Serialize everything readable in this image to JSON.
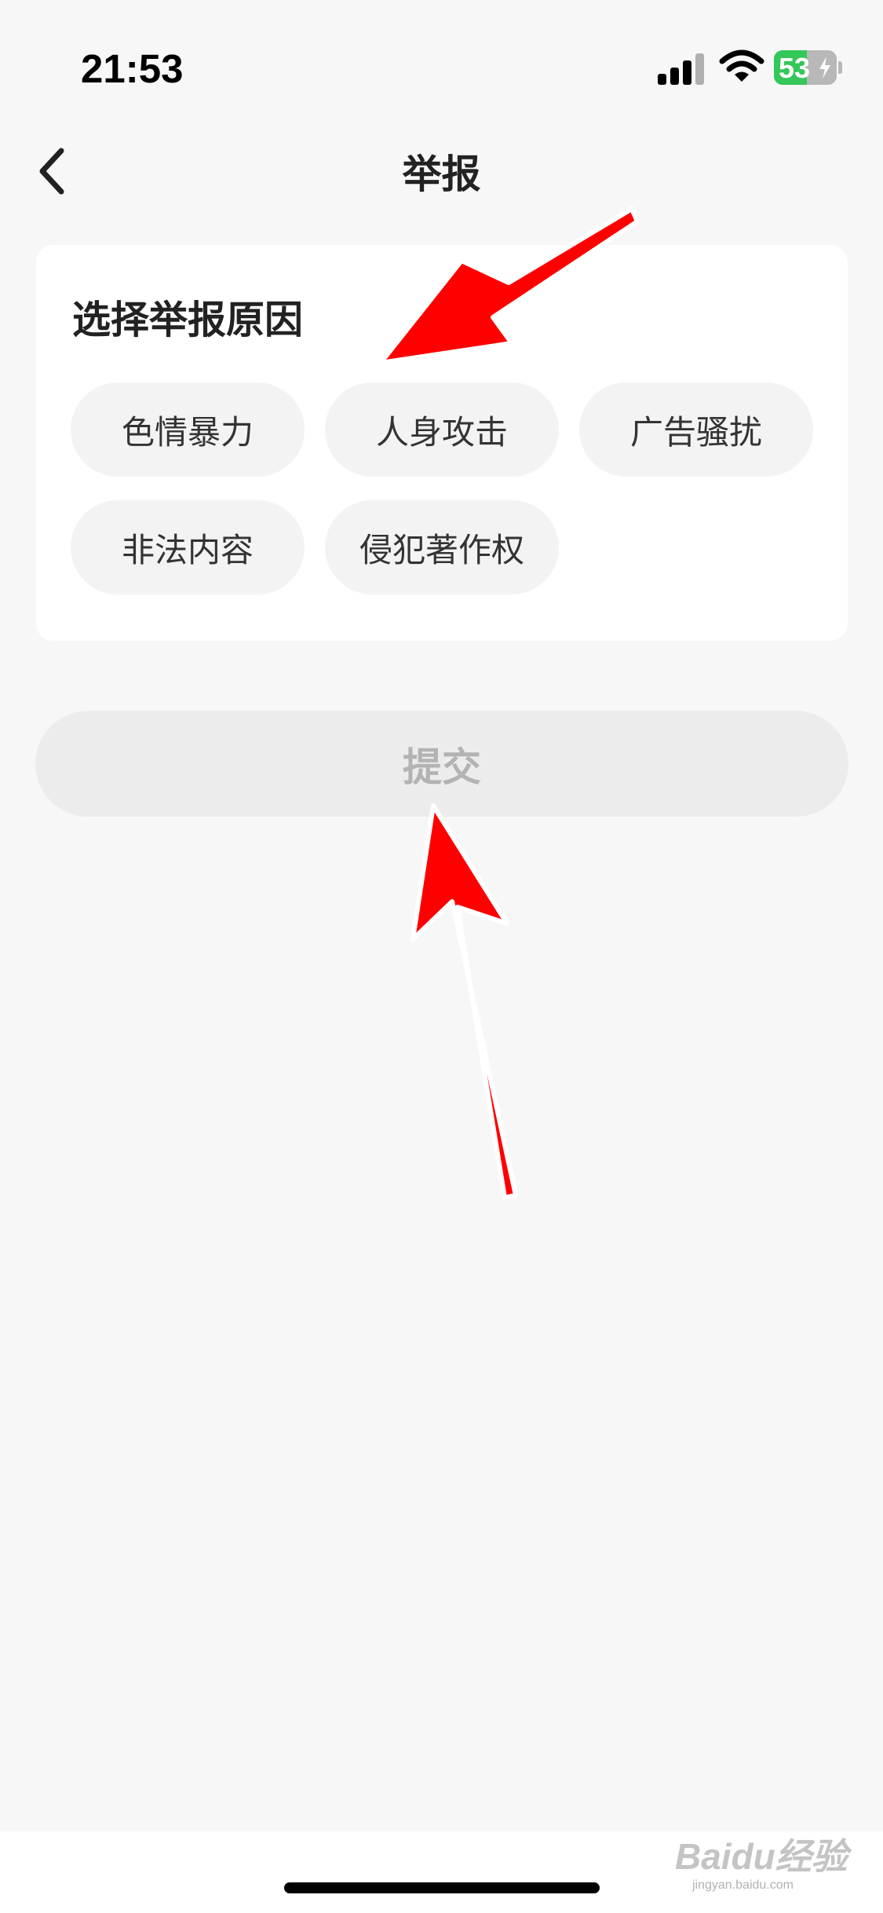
{
  "status_bar": {
    "time": "21:53",
    "battery_percent": 53,
    "battery_label": "53",
    "battery_color": "#34c759"
  },
  "nav": {
    "title": "举报",
    "back_icon": "chevron-left-icon"
  },
  "report_card": {
    "title": "选择举报原因",
    "reasons": [
      "色情暴力",
      "人身攻击",
      "广告骚扰",
      "非法内容",
      "侵犯著作权"
    ]
  },
  "submit": {
    "label": "提交",
    "enabled": false
  },
  "annotations": {
    "arrow_color": "#ff0000",
    "arrow_count": 2
  },
  "watermark": {
    "text": "Baidu经验",
    "url_text": "jingyan.baidu.com"
  }
}
